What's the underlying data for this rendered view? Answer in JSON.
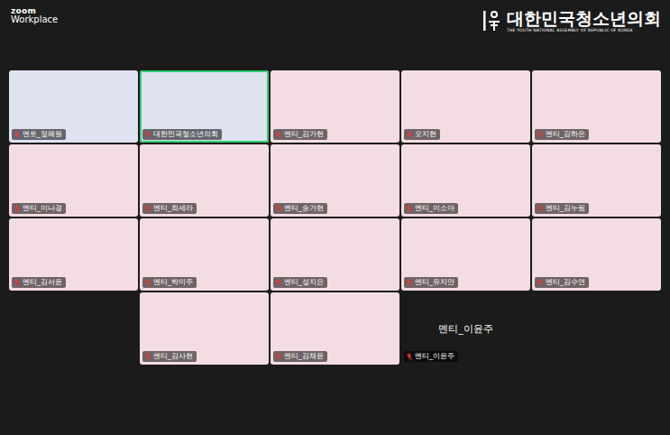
{
  "app": {
    "brand": "zoom",
    "product": "Workplace"
  },
  "watermark": {
    "title": "대한민국청소년의회",
    "subtitle": "THE YOUTH NATIONAL ASSEMBLY OF REPUBLIC OF KOREA"
  },
  "participants": [
    {
      "name": "멘토_정혜원",
      "muted": true,
      "speaking": false,
      "kind": "video"
    },
    {
      "name": "대한민국청소년의회",
      "muted": true,
      "speaking": true,
      "kind": "video"
    },
    {
      "name": "멘티_김가현",
      "muted": true,
      "speaking": false,
      "kind": "video"
    },
    {
      "name": "오지현",
      "muted": true,
      "speaking": false,
      "kind": "video"
    },
    {
      "name": "멘티_김하은",
      "muted": true,
      "speaking": false,
      "kind": "video"
    },
    {
      "name": "멘티_이나경",
      "muted": true,
      "speaking": false,
      "kind": "video"
    },
    {
      "name": "멘티_최세라",
      "muted": true,
      "speaking": false,
      "kind": "video"
    },
    {
      "name": "멘티_송가현",
      "muted": true,
      "speaking": false,
      "kind": "video"
    },
    {
      "name": "멘티_이소아",
      "muted": true,
      "speaking": false,
      "kind": "video"
    },
    {
      "name": "멘티_김누림",
      "muted": true,
      "speaking": false,
      "kind": "video"
    },
    {
      "name": "멘티_김서윤",
      "muted": true,
      "speaking": false,
      "kind": "video"
    },
    {
      "name": "멘티_박미주",
      "muted": true,
      "speaking": false,
      "kind": "video"
    },
    {
      "name": "멘티_성지은",
      "muted": true,
      "speaking": false,
      "kind": "video"
    },
    {
      "name": "멘티_유지안",
      "muted": true,
      "speaking": false,
      "kind": "video"
    },
    {
      "name": "멘티_김수연",
      "muted": true,
      "speaking": false,
      "kind": "video"
    },
    {
      "name": "멘티_김사현",
      "muted": true,
      "speaking": false,
      "kind": "video"
    },
    {
      "name": "멘티_김채윤",
      "muted": true,
      "speaking": false,
      "kind": "video"
    },
    {
      "name": "멘티_이윤주",
      "muted": true,
      "speaking": false,
      "kind": "empty"
    }
  ]
}
